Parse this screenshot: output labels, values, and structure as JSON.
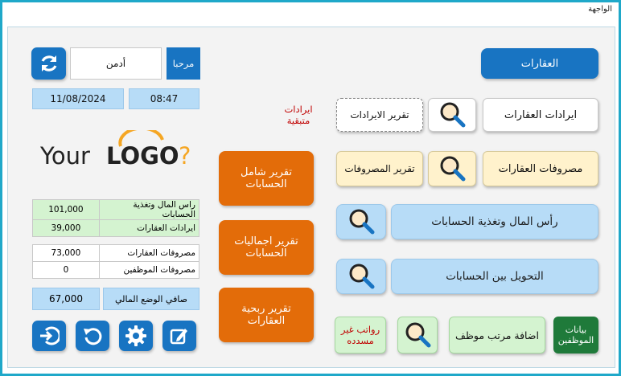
{
  "window": {
    "title": "الواجهة"
  },
  "header": {
    "welcome_label": "مرحبا",
    "user_name": "أدمن",
    "time": "08:47",
    "date": "11/08/2024"
  },
  "logo": {
    "text_your": "Your",
    "text_logo": "LOGO",
    "question": "?"
  },
  "summary": {
    "group1": [
      {
        "label": "راس المال وتغذية الحسابات",
        "value": "101,000"
      },
      {
        "label": "ايرادات العقارات",
        "value": "39,000"
      }
    ],
    "group2": [
      {
        "label": "مصروفات العقارات",
        "value": "73,000"
      },
      {
        "label": "مصروفات الموظفين",
        "value": "0"
      }
    ],
    "net": {
      "label": "صافي الوضع المالي",
      "value": "67,000"
    }
  },
  "buttons": {
    "properties": "العقارات",
    "property_revenues": "ايرادات العقارات",
    "revenues_report": "تقرير الايرادات",
    "remaining_revenues": "ايرادات متبقية",
    "property_expenses": "مصروفات العقارات",
    "expenses_report": "تقرير المصروفات",
    "comprehensive_report": "تقرير شامل الحسابات",
    "capital_funding": "رأس المال وتغذية الحسابات",
    "totals_report": "تقرير اجماليات الحسابات",
    "transfer_accounts": "التحويل بين الحسابات",
    "profitability_report": "تقرير ربحية العقارات",
    "employee_data": "بيانات الموظفين",
    "add_salary": "اضافة مرتب موظف",
    "unpaid_salaries": "رواتب غير مسدده"
  },
  "colors": {
    "accent_blue": "#1874c2",
    "orange": "#e36c09",
    "light_blue": "#b7dcf7",
    "mint": "#d4f3d0",
    "green": "#1f7a3a",
    "cream": "#fff2cc",
    "remaining_text": "#c00000",
    "unpaid_text": "#c00000"
  },
  "icons": [
    "refresh-icon",
    "search-icon",
    "logout-icon",
    "undo-icon",
    "gear-icon",
    "edit-icon"
  ]
}
